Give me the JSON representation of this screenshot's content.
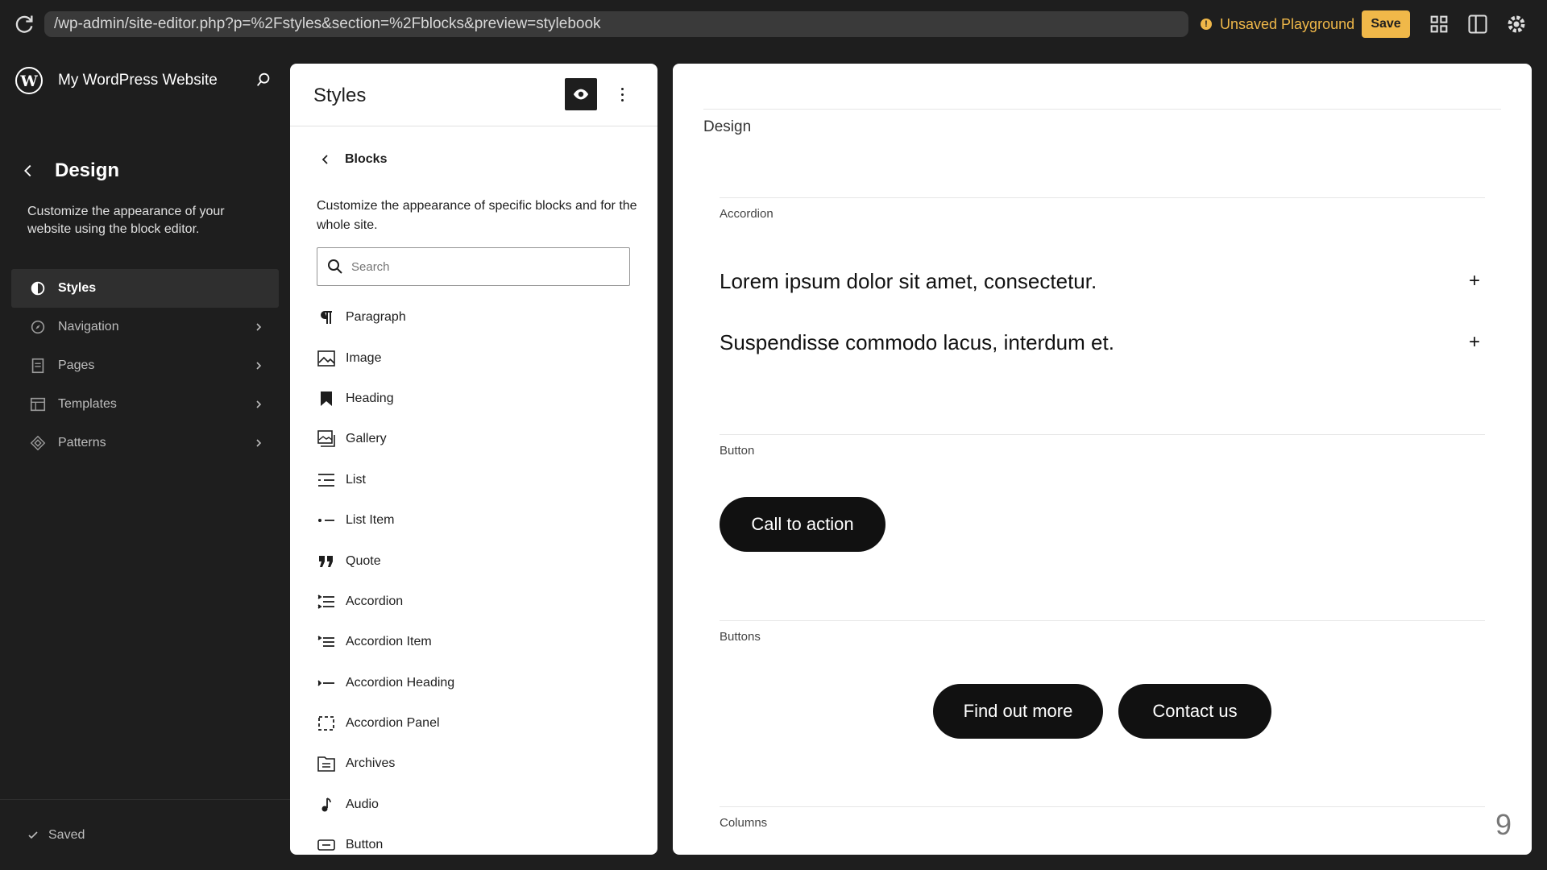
{
  "browser": {
    "url": "/wp-admin/site-editor.php?p=%2Fstyles&section=%2Fblocks&preview=stylebook",
    "status": "Unsaved Playground",
    "save_label": "Save"
  },
  "sidebar": {
    "site_name": "My WordPress Website",
    "section_title": "Design",
    "section_description": "Customize the appearance of your website using the block editor.",
    "items": [
      {
        "label": "Styles",
        "icon": "half-circle-icon",
        "active": true
      },
      {
        "label": "Navigation",
        "icon": "compass-icon"
      },
      {
        "label": "Pages",
        "icon": "page-icon"
      },
      {
        "label": "Templates",
        "icon": "layout-icon"
      },
      {
        "label": "Patterns",
        "icon": "symbol-icon"
      }
    ],
    "footer_status": "Saved"
  },
  "styles_panel": {
    "title": "Styles",
    "back_label": "Blocks",
    "description": "Customize the appearance of specific blocks and for the whole site.",
    "search_placeholder": "Search",
    "blocks": [
      {
        "label": "Paragraph",
        "icon": "paragraph-icon"
      },
      {
        "label": "Image",
        "icon": "image-icon"
      },
      {
        "label": "Heading",
        "icon": "bookmark-icon"
      },
      {
        "label": "Gallery",
        "icon": "gallery-icon"
      },
      {
        "label": "List",
        "icon": "list-icon"
      },
      {
        "label": "List Item",
        "icon": "list-item-icon"
      },
      {
        "label": "Quote",
        "icon": "quote-icon"
      },
      {
        "label": "Accordion",
        "icon": "accordion-icon"
      },
      {
        "label": "Accordion Item",
        "icon": "accordion-item-icon"
      },
      {
        "label": "Accordion Heading",
        "icon": "accordion-heading-icon"
      },
      {
        "label": "Accordion Panel",
        "icon": "accordion-panel-icon"
      },
      {
        "label": "Archives",
        "icon": "archive-icon"
      },
      {
        "label": "Audio",
        "icon": "audio-icon"
      },
      {
        "label": "Button",
        "icon": "button-icon"
      }
    ]
  },
  "preview": {
    "heading": "Design",
    "sections": {
      "accordion": "Accordion",
      "button": "Button",
      "buttons": "Buttons",
      "columns": "Columns"
    },
    "accordion_items": [
      "Lorem ipsum dolor sit amet, consectetur.",
      "Suspendisse commodo lacus, interdum et."
    ],
    "accordion_toggle": "+",
    "cta_label": "Call to action",
    "buttons": [
      "Find out more",
      "Contact us"
    ],
    "column_number": "9"
  },
  "colors": {
    "accent": "#f0b849",
    "dark": "#1e1e1e",
    "button_bg": "#111111"
  }
}
